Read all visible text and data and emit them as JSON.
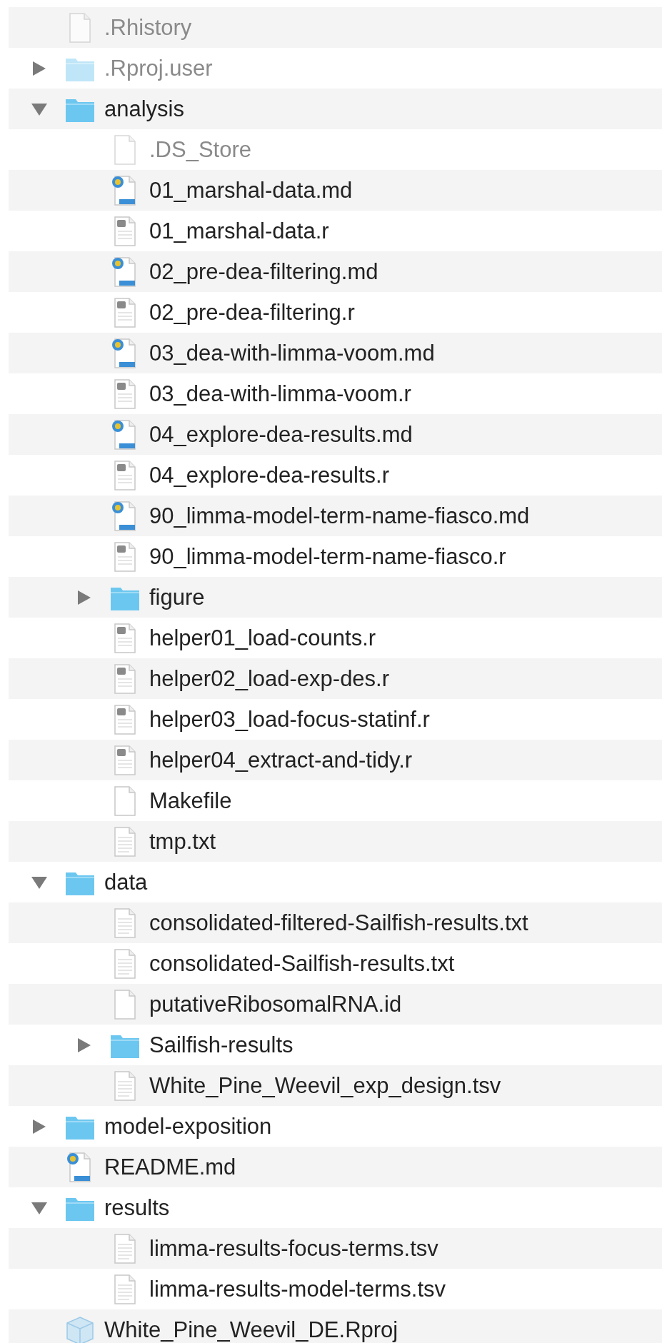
{
  "files": [
    {
      "name": ".Rhistory",
      "kind": "file",
      "hidden": true
    },
    {
      "name": ".Rproj.user",
      "kind": "folder",
      "hidden": true,
      "expanded": false
    },
    {
      "name": "analysis",
      "kind": "folder",
      "hidden": false,
      "expanded": true,
      "children": [
        {
          "name": ".DS_Store",
          "kind": "file",
          "hidden": true
        },
        {
          "name": "01_marshal-data.md",
          "kind": "markdown",
          "hidden": false
        },
        {
          "name": "01_marshal-data.r",
          "kind": "script",
          "hidden": false
        },
        {
          "name": "02_pre-dea-filtering.md",
          "kind": "markdown",
          "hidden": false
        },
        {
          "name": "02_pre-dea-filtering.r",
          "kind": "script",
          "hidden": false
        },
        {
          "name": "03_dea-with-limma-voom.md",
          "kind": "markdown",
          "hidden": false
        },
        {
          "name": "03_dea-with-limma-voom.r",
          "kind": "script",
          "hidden": false
        },
        {
          "name": "04_explore-dea-results.md",
          "kind": "markdown",
          "hidden": false
        },
        {
          "name": "04_explore-dea-results.r",
          "kind": "script",
          "hidden": false
        },
        {
          "name": "90_limma-model-term-name-fiasco.md",
          "kind": "markdown",
          "hidden": false
        },
        {
          "name": "90_limma-model-term-name-fiasco.r",
          "kind": "script",
          "hidden": false
        },
        {
          "name": "figure",
          "kind": "folder",
          "hidden": false,
          "expanded": false
        },
        {
          "name": "helper01_load-counts.r",
          "kind": "script",
          "hidden": false
        },
        {
          "name": "helper02_load-exp-des.r",
          "kind": "script",
          "hidden": false
        },
        {
          "name": "helper03_load-focus-statinf.r",
          "kind": "script",
          "hidden": false
        },
        {
          "name": "helper04_extract-and-tidy.r",
          "kind": "script",
          "hidden": false
        },
        {
          "name": "Makefile",
          "kind": "file",
          "hidden": false
        },
        {
          "name": "tmp.txt",
          "kind": "text",
          "hidden": false
        }
      ]
    },
    {
      "name": "data",
      "kind": "folder",
      "hidden": false,
      "expanded": true,
      "children": [
        {
          "name": "consolidated-filtered-Sailfish-results.txt",
          "kind": "text",
          "hidden": false
        },
        {
          "name": "consolidated-Sailfish-results.txt",
          "kind": "text",
          "hidden": false
        },
        {
          "name": "putativeRibosomalRNA.id",
          "kind": "file",
          "hidden": false
        },
        {
          "name": "Sailfish-results",
          "kind": "folder",
          "hidden": false,
          "expanded": false
        },
        {
          "name": "White_Pine_Weevil_exp_design.tsv",
          "kind": "text",
          "hidden": false
        }
      ]
    },
    {
      "name": "model-exposition",
      "kind": "folder",
      "hidden": false,
      "expanded": false
    },
    {
      "name": "README.md",
      "kind": "markdown",
      "hidden": false
    },
    {
      "name": "results",
      "kind": "folder",
      "hidden": false,
      "expanded": true,
      "children": [
        {
          "name": "limma-results-focus-terms.tsv",
          "kind": "text",
          "hidden": false
        },
        {
          "name": "limma-results-model-terms.tsv",
          "kind": "text",
          "hidden": false
        }
      ]
    },
    {
      "name": "White_Pine_Weevil_DE.Rproj",
      "kind": "project",
      "hidden": false
    }
  ]
}
